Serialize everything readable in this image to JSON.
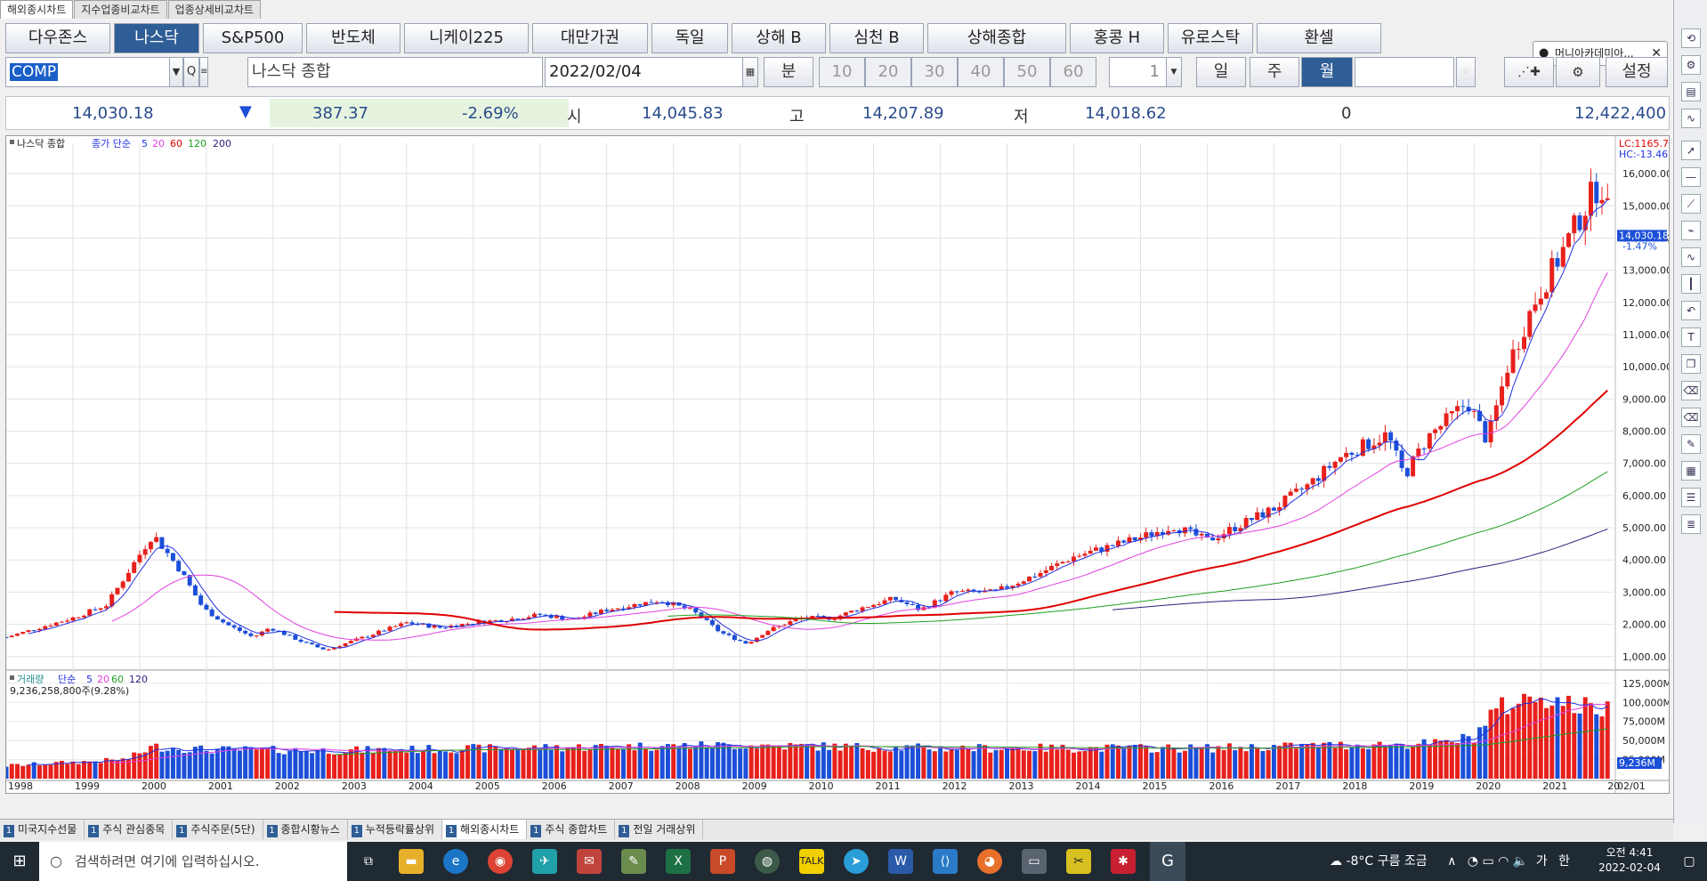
{
  "top_tabs": [
    "해외종시차트",
    "지수업종비교차트",
    "업종상세비교차트"
  ],
  "markets": [
    "다우존스",
    "나스닥",
    "S&P500",
    "반도체",
    "니케이225",
    "대만가권",
    "독일",
    "상해 B",
    "심천 B",
    "상해종합",
    "홍콩 H",
    "유로스탁",
    "환셀"
  ],
  "active_market": "나스닥",
  "controls": {
    "code": "COMP",
    "name": "나스닥 종합",
    "date": "2022/02/04",
    "unit": "분",
    "intervals": [
      "10",
      "20",
      "30",
      "40",
      "50",
      "60"
    ],
    "count": "1",
    "periods": [
      "일",
      "주",
      "월"
    ],
    "active_period": "월",
    "settings": "설정"
  },
  "popup": {
    "text": "머니아카데미아..."
  },
  "info": {
    "price": "14,030.18",
    "arrow": "▼",
    "change": "387.37",
    "pct": "-2.69%",
    "open_label": "시",
    "open": "14,045.83",
    "high_label": "고",
    "high": "14,207.89",
    "low_label": "저",
    "low": "14,018.62",
    "vol": "0",
    "amount": "12,422,400"
  },
  "price_panel": {
    "title": "나스닥 종합",
    "legend_prefix": "종가 단순",
    "ma": [
      "5",
      "20",
      "60",
      "120",
      "200"
    ],
    "lc": "LC:1165.70",
    "hc": "HC:-13.46",
    "last_label": "14,030.18",
    "last_pct": "-1.47%",
    "yticks": [
      "16,000.00",
      "15,000.00",
      "14,000.00",
      "13,000.00",
      "12,000.00",
      "11,000.00",
      "10,000.00",
      "9,000.00",
      "8,000.00",
      "7,000.00",
      "6,000.00",
      "5,000.00",
      "4,000.00",
      "3,000.00",
      "2,000.00",
      "1,000.00"
    ]
  },
  "volume_panel": {
    "title": "거래량",
    "legend_prefix": "단순",
    "ma": [
      "5",
      "20",
      "60",
      "120"
    ],
    "detail": "9,236,258,800주(9.28%)",
    "yticks": [
      "125,000M",
      "100,000M",
      "75,000M",
      "50,000M",
      "25,000M"
    ],
    "last_label": "9,236M",
    "last_pct": "9.28%"
  },
  "xaxis": [
    "1998",
    "1999",
    "2000",
    "2001",
    "2002",
    "2003",
    "2004",
    "2005",
    "2006",
    "2007",
    "2008",
    "2009",
    "2010",
    "2011",
    "2012",
    "2013",
    "2014",
    "2015",
    "2016",
    "2017",
    "2018",
    "2019",
    "2020",
    "2021",
    "20",
    "02/01"
  ],
  "chart_data": {
    "type": "candlestick",
    "title": "나스닥 종합",
    "x_label": "",
    "y_range": [
      800,
      16500
    ],
    "close_anchors": [
      [
        1998.0,
        1600
      ],
      [
        1999.0,
        2200
      ],
      [
        1999.5,
        2600
      ],
      [
        2000.2,
        4800
      ],
      [
        2000.6,
        3700
      ],
      [
        2000.95,
        2500
      ],
      [
        2001.3,
        2000
      ],
      [
        2001.7,
        1600
      ],
      [
        2001.95,
        1900
      ],
      [
        2002.5,
        1400
      ],
      [
        2002.8,
        1200
      ],
      [
        2003.0,
        1350
      ],
      [
        2003.5,
        1700
      ],
      [
        2004.0,
        2050
      ],
      [
        2004.5,
        1900
      ],
      [
        2005.0,
        2050
      ],
      [
        2005.5,
        2150
      ],
      [
        2006.0,
        2300
      ],
      [
        2006.5,
        2150
      ],
      [
        2007.0,
        2450
      ],
      [
        2007.8,
        2750
      ],
      [
        2008.3,
        2400
      ],
      [
        2008.7,
        1750
      ],
      [
        2009.1,
        1400
      ],
      [
        2009.4,
        1800
      ],
      [
        2009.9,
        2200
      ],
      [
        2010.4,
        2200
      ],
      [
        2010.8,
        2500
      ],
      [
        2011.3,
        2800
      ],
      [
        2011.7,
        2450
      ],
      [
        2012.2,
        3000
      ],
      [
        2012.8,
        3000
      ],
      [
        2013.5,
        3600
      ],
      [
        2014.0,
        4100
      ],
      [
        2014.5,
        4400
      ],
      [
        2015.0,
        4700
      ],
      [
        2015.5,
        5050
      ],
      [
        2016.0,
        4600
      ],
      [
        2016.5,
        5100
      ],
      [
        2017.0,
        5600
      ],
      [
        2017.5,
        6300
      ],
      [
        2018.0,
        7200
      ],
      [
        2018.7,
        7900
      ],
      [
        2018.95,
        6600
      ],
      [
        2019.3,
        7800
      ],
      [
        2019.9,
        8900
      ],
      [
        2020.2,
        7700
      ],
      [
        2020.5,
        10000
      ],
      [
        2020.9,
        12000
      ],
      [
        2021.3,
        13500
      ],
      [
        2021.8,
        15500
      ],
      [
        2021.95,
        15600
      ],
      [
        2022.05,
        14030
      ]
    ],
    "volume_anchors": [
      [
        1998.0,
        17
      ],
      [
        1999.8,
        25
      ],
      [
        2000.2,
        42
      ],
      [
        2001.0,
        38
      ],
      [
        2003.0,
        37
      ],
      [
        2007.0,
        42
      ],
      [
        2009.0,
        44
      ],
      [
        2012.0,
        40
      ],
      [
        2016.0,
        40
      ],
      [
        2018.0,
        44
      ],
      [
        2019.5,
        46
      ],
      [
        2020.0,
        55
      ],
      [
        2020.3,
        90
      ],
      [
        2021.0,
        110
      ],
      [
        2021.5,
        95
      ],
      [
        2022.0,
        92
      ],
      [
        2022.08,
        9
      ]
    ],
    "volume_y_range": [
      0,
      140
    ],
    "series": [
      {
        "name": "5"
      },
      {
        "name": "20"
      },
      {
        "name": "60"
      },
      {
        "name": "120"
      },
      {
        "name": "200"
      }
    ]
  },
  "bottom_tabs": [
    "미국지수선물",
    "주식 관심종목",
    "주식주문(5단)",
    "종합시황뉴스",
    "누적등락률상위",
    "해외종시차트",
    "주식 종합차트",
    "전일 거래상위"
  ],
  "active_bottom": "해외종시차트",
  "taskbar": {
    "search": "검색하려면 여기에 입력하십시오.",
    "weather": "-8°C 구름 조금",
    "ime": "가",
    "lang": "한",
    "time": "오전 4:41",
    "date": "2022-02-04"
  },
  "colors": {
    "up": "#e8201c",
    "down": "#1c4fd8",
    "ma5": "#2030e0",
    "ma20": "#e040e0",
    "ma60": "#e00000",
    "ma120": "#20a020",
    "ma200": "#302080"
  }
}
